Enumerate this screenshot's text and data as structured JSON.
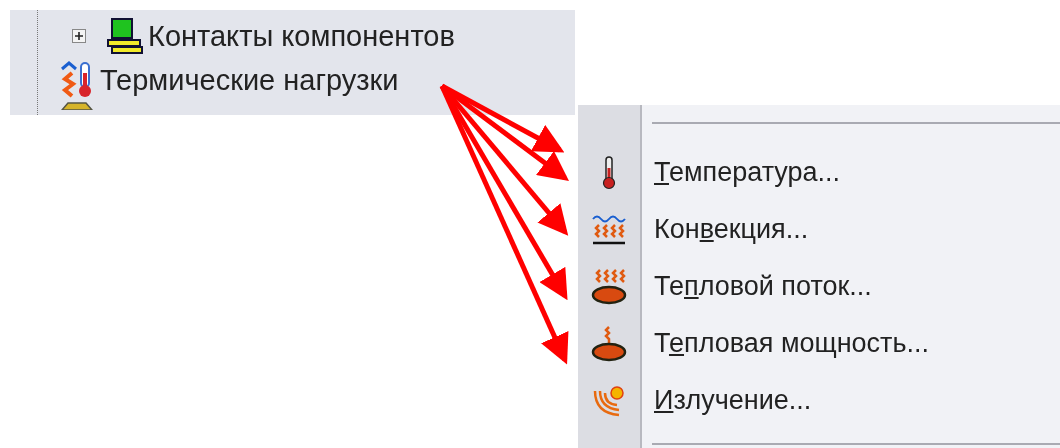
{
  "tree": {
    "items": [
      {
        "label": "Контакты компонентов",
        "expandable": true,
        "kind": "contacts"
      },
      {
        "label": "Термические нагрузки",
        "expandable": false,
        "kind": "thermal"
      },
      {
        "expandable": false,
        "kind": "partial"
      }
    ]
  },
  "menu": {
    "items": [
      {
        "kind": "thermometer",
        "key": "Т",
        "after": "емпература..."
      },
      {
        "kind": "convection",
        "before": "Кон",
        "key": "в",
        "after": "екция..."
      },
      {
        "kind": "flux",
        "before": "Те",
        "key": "п",
        "after": "ловой поток..."
      },
      {
        "kind": "power",
        "before": "Т",
        "key": "е",
        "after": "пловая мощность..."
      },
      {
        "kind": "radiation",
        "key": "И",
        "after": "злучение..."
      }
    ]
  }
}
